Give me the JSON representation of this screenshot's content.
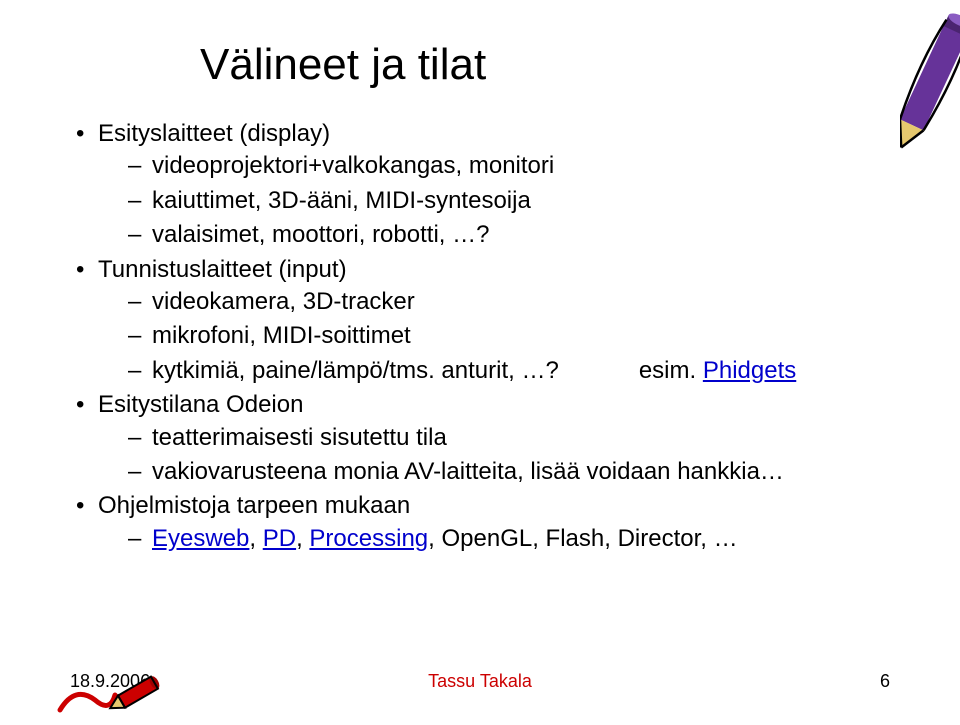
{
  "title": "Välineet ja tilat",
  "b1": {
    "a": "Esityslaitteet (display)",
    "a_sub": {
      "s1": "videoprojektori+valkokangas, monitori",
      "s2": "kaiuttimet, 3D-ääni, MIDI-syntesoija",
      "s3": "valaisimet, moottori, robotti, …?"
    },
    "b": "Tunnistuslaitteet (input)",
    "b_sub": {
      "s1": "videokamera, 3D-tracker",
      "s2": "mikrofoni, MIDI-soittimet",
      "s3": "kytkimiä, paine/lämpö/tms. anturit, …?",
      "s3_esim": "esim. ",
      "s3_link": "Phidgets"
    },
    "c": "Esitystilana Odeion",
    "c_sub": {
      "s1": "teatterimaisesti sisutettu tila",
      "s2": "vakiovarusteena monia AV-laitteita, lisää voidaan hankkia…"
    },
    "d": "Ohjelmistoja tarpeen mukaan",
    "d_sub": {
      "link1": "Eyesweb",
      "link2": "PD",
      "link3": "Processing",
      "rest": ", OpenGL, Flash, Director, …",
      "sep": ", "
    }
  },
  "footer": {
    "date": "18.9.2006",
    "author": "Tassu Takala",
    "page": "6"
  }
}
